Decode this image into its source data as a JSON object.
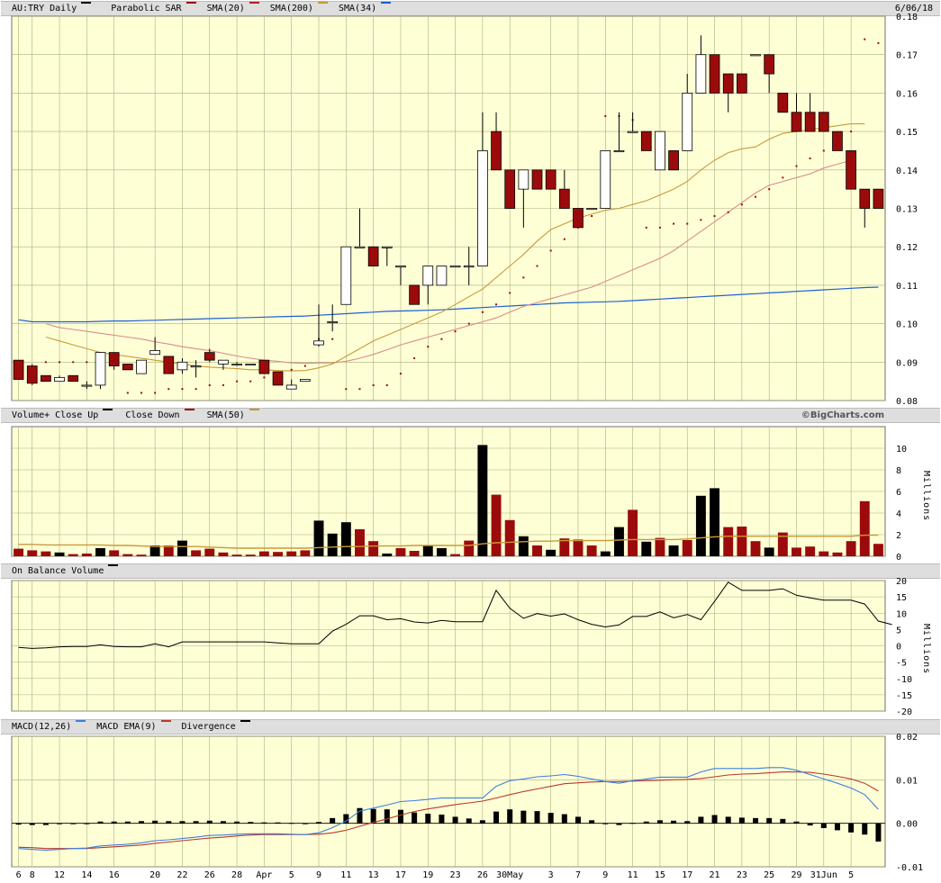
{
  "header": {
    "symbol_label": "AU:TRY Daily",
    "sar_label": "Parabolic SAR",
    "sma20_label": "SMA(20)",
    "sma200_label": "SMA(200)",
    "sma34_label": "SMA(34)",
    "date": "6/06/18"
  },
  "volume_header": {
    "label": "Volume+ Close Up",
    "close_down_label": "Close Down",
    "sma50_label": "SMA(50)",
    "credit": "©BigCharts.com"
  },
  "obv_header": {
    "label": "On Balance Volume"
  },
  "macd_header": {
    "macd_label": "MACD(12,26)",
    "ema_label": "MACD EMA(9)",
    "div_label": "Divergence"
  },
  "colors": {
    "up": "#000000",
    "down": "#9b0b0b",
    "sma20": "#b2221f",
    "sma200": "#1f5fd1",
    "sma34": "#d98c8c",
    "sma50": "#c89a3a",
    "macd": "#3d7fe0",
    "ema": "#b83a2a",
    "grid": "#a7b07a",
    "panel": "#ffffd6"
  },
  "chart_data": [
    {
      "type": "candlestick",
      "title": "AU:TRY Daily",
      "ylim": [
        0.08,
        0.18
      ],
      "y_ticks": [
        "0.18",
        "0.17",
        "0.16",
        "0.15",
        "0.14",
        "0.13",
        "0.12",
        "0.11",
        "0.10",
        "0.09",
        "0.08"
      ],
      "x_tick_labels": [
        "6",
        "8",
        "12",
        "14",
        "16",
        "20",
        "22",
        "26",
        "28",
        "Apr",
        "5",
        "9",
        "11",
        "13",
        "17",
        "19",
        "23",
        "26",
        "30May",
        "3",
        "7",
        "9",
        "11",
        "15",
        "17",
        "21",
        "23",
        "25",
        "29",
        "31Jun",
        "5"
      ],
      "candles": [
        {
          "o": 0.0905,
          "h": 0.0905,
          "l": 0.0855,
          "c": 0.0855
        },
        {
          "o": 0.089,
          "h": 0.0895,
          "l": 0.084,
          "c": 0.0845
        },
        {
          "o": 0.0865,
          "h": 0.0865,
          "l": 0.085,
          "c": 0.085
        },
        {
          "o": 0.085,
          "h": 0.0865,
          "l": 0.085,
          "c": 0.086
        },
        {
          "o": 0.0865,
          "h": 0.0865,
          "l": 0.085,
          "c": 0.085
        },
        {
          "o": 0.084,
          "h": 0.085,
          "l": 0.083,
          "c": 0.084
        },
        {
          "o": 0.084,
          "h": 0.0925,
          "l": 0.083,
          "c": 0.0925
        },
        {
          "o": 0.0925,
          "h": 0.0925,
          "l": 0.088,
          "c": 0.089
        },
        {
          "o": 0.0895,
          "h": 0.0895,
          "l": 0.088,
          "c": 0.088
        },
        {
          "o": 0.087,
          "h": 0.0905,
          "l": 0.087,
          "c": 0.0905
        },
        {
          "o": 0.092,
          "h": 0.0965,
          "l": 0.092,
          "c": 0.093
        },
        {
          "o": 0.0915,
          "h": 0.0915,
          "l": 0.087,
          "c": 0.087
        },
        {
          "o": 0.088,
          "h": 0.091,
          "l": 0.087,
          "c": 0.09
        },
        {
          "o": 0.089,
          "h": 0.0905,
          "l": 0.086,
          "c": 0.089
        },
        {
          "o": 0.0925,
          "h": 0.0935,
          "l": 0.09,
          "c": 0.0905
        },
        {
          "o": 0.0895,
          "h": 0.0905,
          "l": 0.088,
          "c": 0.0905
        },
        {
          "o": 0.0895,
          "h": 0.09,
          "l": 0.089,
          "c": 0.0895
        },
        {
          "o": 0.0895,
          "h": 0.0895,
          "l": 0.0895,
          "c": 0.0895
        },
        {
          "o": 0.0905,
          "h": 0.0905,
          "l": 0.087,
          "c": 0.087
        },
        {
          "o": 0.0875,
          "h": 0.0875,
          "l": 0.084,
          "c": 0.084
        },
        {
          "o": 0.083,
          "h": 0.0855,
          "l": 0.083,
          "c": 0.084
        },
        {
          "o": 0.085,
          "h": 0.0855,
          "l": 0.085,
          "c": 0.0855
        },
        {
          "o": 0.0945,
          "h": 0.105,
          "l": 0.094,
          "c": 0.0955
        },
        {
          "o": 0.1005,
          "h": 0.105,
          "l": 0.098,
          "c": 0.1005
        },
        {
          "o": 0.105,
          "h": 0.12,
          "l": 0.105,
          "c": 0.12
        },
        {
          "o": 0.12,
          "h": 0.13,
          "l": 0.12,
          "c": 0.12
        },
        {
          "o": 0.12,
          "h": 0.12,
          "l": 0.115,
          "c": 0.115
        },
        {
          "o": 0.12,
          "h": 0.12,
          "l": 0.115,
          "c": 0.12
        },
        {
          "o": 0.115,
          "h": 0.115,
          "l": 0.11,
          "c": 0.115
        },
        {
          "o": 0.11,
          "h": 0.11,
          "l": 0.105,
          "c": 0.105
        },
        {
          "o": 0.11,
          "h": 0.115,
          "l": 0.105,
          "c": 0.115
        },
        {
          "o": 0.11,
          "h": 0.115,
          "l": 0.11,
          "c": 0.115
        },
        {
          "o": 0.115,
          "h": 0.115,
          "l": 0.115,
          "c": 0.115
        },
        {
          "o": 0.115,
          "h": 0.12,
          "l": 0.11,
          "c": 0.115
        },
        {
          "o": 0.115,
          "h": 0.155,
          "l": 0.115,
          "c": 0.145
        },
        {
          "o": 0.15,
          "h": 0.155,
          "l": 0.14,
          "c": 0.14
        },
        {
          "o": 0.14,
          "h": 0.14,
          "l": 0.13,
          "c": 0.13
        },
        {
          "o": 0.135,
          "h": 0.14,
          "l": 0.125,
          "c": 0.14
        },
        {
          "o": 0.14,
          "h": 0.14,
          "l": 0.135,
          "c": 0.135
        },
        {
          "o": 0.14,
          "h": 0.14,
          "l": 0.135,
          "c": 0.135
        },
        {
          "o": 0.135,
          "h": 0.14,
          "l": 0.13,
          "c": 0.13
        },
        {
          "o": 0.13,
          "h": 0.13,
          "l": 0.125,
          "c": 0.125
        },
        {
          "o": 0.13,
          "h": 0.13,
          "l": 0.13,
          "c": 0.13
        },
        {
          "o": 0.13,
          "h": 0.145,
          "l": 0.13,
          "c": 0.145
        },
        {
          "o": 0.145,
          "h": 0.155,
          "l": 0.145,
          "c": 0.145
        },
        {
          "o": 0.15,
          "h": 0.155,
          "l": 0.15,
          "c": 0.15
        },
        {
          "o": 0.15,
          "h": 0.15,
          "l": 0.145,
          "c": 0.145
        },
        {
          "o": 0.14,
          "h": 0.15,
          "l": 0.14,
          "c": 0.15
        },
        {
          "o": 0.145,
          "h": 0.145,
          "l": 0.14,
          "c": 0.14
        },
        {
          "o": 0.145,
          "h": 0.165,
          "l": 0.145,
          "c": 0.16
        },
        {
          "o": 0.16,
          "h": 0.175,
          "l": 0.16,
          "c": 0.17
        },
        {
          "o": 0.17,
          "h": 0.17,
          "l": 0.16,
          "c": 0.16
        },
        {
          "o": 0.165,
          "h": 0.165,
          "l": 0.155,
          "c": 0.16
        },
        {
          "o": 0.165,
          "h": 0.165,
          "l": 0.16,
          "c": 0.16
        },
        {
          "o": 0.17,
          "h": 0.17,
          "l": 0.17,
          "c": 0.17
        },
        {
          "o": 0.17,
          "h": 0.17,
          "l": 0.16,
          "c": 0.165
        },
        {
          "o": 0.16,
          "h": 0.16,
          "l": 0.155,
          "c": 0.155
        },
        {
          "o": 0.155,
          "h": 0.16,
          "l": 0.15,
          "c": 0.15
        },
        {
          "o": 0.155,
          "h": 0.16,
          "l": 0.15,
          "c": 0.15
        },
        {
          "o": 0.155,
          "h": 0.155,
          "l": 0.15,
          "c": 0.15
        },
        {
          "o": 0.15,
          "h": 0.15,
          "l": 0.145,
          "c": 0.145
        },
        {
          "o": 0.145,
          "h": 0.145,
          "l": 0.135,
          "c": 0.135
        },
        {
          "o": 0.135,
          "h": 0.135,
          "l": 0.125,
          "c": 0.13
        },
        {
          "o": 0.135,
          "h": 0.135,
          "l": 0.13,
          "c": 0.13
        }
      ],
      "sar": [
        0.09,
        null,
        0.09,
        0.09,
        0.09,
        0.09,
        0.09,
        0.09,
        0.082,
        0.082,
        0.082,
        0.083,
        0.083,
        0.083,
        0.084,
        0.084,
        0.085,
        0.085,
        0.086,
        0.087,
        0.088,
        0.089,
        0.096,
        0.096,
        0.083,
        0.083,
        0.084,
        0.084,
        0.087,
        0.091,
        0.094,
        0.096,
        0.098,
        0.1,
        0.103,
        0.105,
        0.108,
        0.112,
        0.115,
        0.119,
        0.122,
        0.125,
        0.128,
        0.154,
        0.154,
        0.153,
        0.125,
        0.125,
        0.126,
        0.126,
        0.127,
        0.128,
        0.129,
        0.131,
        0.133,
        0.135,
        0.138,
        0.141,
        0.143,
        0.145,
        0.147,
        0.15,
        0.174,
        0.173
      ],
      "sma20": [
        null,
        null,
        0.0965,
        0.0955,
        0.0945,
        0.0935,
        0.0925,
        0.092,
        0.0915,
        0.091,
        0.0905,
        0.09,
        0.0895,
        0.089,
        0.0887,
        0.0885,
        0.0883,
        0.088,
        0.088,
        0.0878,
        0.0877,
        0.0878,
        0.0885,
        0.0895,
        0.0915,
        0.0935,
        0.0955,
        0.097,
        0.0985,
        0.1,
        0.1015,
        0.103,
        0.105,
        0.107,
        0.109,
        0.112,
        0.115,
        0.118,
        0.1215,
        0.1245,
        0.126,
        0.1275,
        0.1285,
        0.1295,
        0.13,
        0.131,
        0.132,
        0.1335,
        0.135,
        0.137,
        0.14,
        0.1425,
        0.1445,
        0.1455,
        0.146,
        0.148,
        0.1495,
        0.15,
        0.1505,
        0.151,
        0.1515,
        0.152,
        0.152
      ],
      "sma34": [
        null,
        null,
        0.1,
        0.099,
        0.0985,
        0.098,
        0.0975,
        0.097,
        0.0965,
        0.096,
        0.0953,
        0.0947,
        0.094,
        0.0935,
        0.093,
        0.0923,
        0.0916,
        0.091,
        0.0905,
        0.0902,
        0.0898,
        0.0897,
        0.0898,
        0.0898,
        0.0902,
        0.091,
        0.092,
        0.0932,
        0.0945,
        0.0955,
        0.0965,
        0.0975,
        0.0985,
        0.0995,
        0.1005,
        0.1015,
        0.103,
        0.1045,
        0.1055,
        0.1065,
        0.1075,
        0.1085,
        0.1095,
        0.111,
        0.1125,
        0.114,
        0.1155,
        0.117,
        0.119,
        0.1215,
        0.124,
        0.1265,
        0.129,
        0.1315,
        0.134,
        0.136,
        0.137,
        0.138,
        0.139,
        0.1405,
        0.1415,
        0.1425
      ],
      "sma200": [
        0.101,
        0.1005,
        0.1005,
        0.1005,
        0.1005,
        0.1005,
        0.1006,
        0.1007,
        0.1007,
        0.1008,
        0.1009,
        0.101,
        0.1011,
        0.1012,
        0.1013,
        0.1014,
        0.1015,
        0.1016,
        0.1017,
        0.1018,
        0.1019,
        0.102,
        0.1022,
        0.1024,
        0.1026,
        0.1028,
        0.103,
        0.1032,
        0.1033,
        0.1034,
        0.1035,
        0.1036,
        0.1038,
        0.104,
        0.1042,
        0.1044,
        0.1046,
        0.1048,
        0.105,
        0.1052,
        0.1054,
        0.1055,
        0.1056,
        0.1057,
        0.1058,
        0.106,
        0.1062,
        0.1064,
        0.1066,
        0.1068,
        0.107,
        0.1072,
        0.1074,
        0.1076,
        0.1078,
        0.108,
        0.1082,
        0.1084,
        0.1086,
        0.1088,
        0.109,
        0.1092,
        0.1094,
        0.1095
      ]
    },
    {
      "type": "bar",
      "title": "Volume",
      "ylabel": "Millions",
      "ylim": [
        0,
        12
      ],
      "y_ticks": [
        "10",
        "8",
        "6",
        "4",
        "2",
        "0"
      ],
      "values": [
        0.7,
        0.55,
        0.45,
        0.35,
        0.2,
        0.25,
        0.75,
        0.55,
        0.2,
        0.15,
        1.0,
        1.0,
        1.45,
        0.55,
        0.7,
        0.35,
        0.15,
        0.15,
        0.45,
        0.4,
        0.45,
        0.55,
        3.3,
        2.1,
        3.15,
        2.5,
        1.4,
        0.25,
        0.75,
        0.5,
        1.0,
        0.75,
        0.2,
        1.45,
        10.3,
        5.7,
        3.35,
        1.85,
        1.0,
        0.6,
        1.65,
        1.55,
        1.0,
        0.45,
        2.7,
        4.3,
        1.35,
        1.7,
        1.0,
        1.5,
        5.6,
        6.3,
        2.7,
        2.75,
        1.4,
        0.8,
        2.2,
        0.8,
        0.9,
        0.45,
        0.35,
        1.4,
        5.1,
        1.15
      ],
      "up": [
        0,
        0,
        0,
        1,
        0,
        0,
        1,
        0,
        0,
        0,
        1,
        0,
        1,
        0,
        0,
        0,
        0,
        0,
        0,
        0,
        0,
        0,
        1,
        1,
        1,
        0,
        0,
        1,
        0,
        0,
        1,
        1,
        0,
        0,
        1,
        0,
        0,
        1,
        0,
        1,
        0,
        0,
        0,
        1,
        1,
        0,
        1,
        0,
        1,
        0,
        1,
        1,
        0,
        0,
        0,
        1,
        0,
        0,
        0,
        0,
        0,
        0,
        0,
        0
      ],
      "sma50": [
        1.1,
        1.1,
        1.05,
        1.05,
        1.05,
        1.05,
        1.05,
        1.0,
        1.0,
        0.95,
        0.9,
        0.9,
        0.9,
        0.9,
        0.85,
        0.8,
        0.75,
        0.75,
        0.75,
        0.75,
        0.75,
        0.75,
        0.8,
        0.85,
        0.9,
        0.9,
        0.95,
        0.95,
        0.95,
        1.0,
        1.0,
        1.0,
        1.0,
        1.0,
        1.15,
        1.25,
        1.3,
        1.35,
        1.4,
        1.4,
        1.45,
        1.45,
        1.45,
        1.45,
        1.5,
        1.55,
        1.55,
        1.55,
        1.55,
        1.6,
        1.7,
        1.8,
        1.85,
        1.85,
        1.85,
        1.85,
        1.85,
        1.85,
        1.85,
        1.85,
        1.85,
        1.85,
        1.95,
        1.95
      ]
    },
    {
      "type": "line",
      "title": "On Balance Volume",
      "ylabel": "Millions",
      "ylim": [
        -20,
        20
      ],
      "y_ticks": [
        "20",
        "15",
        "10",
        "5",
        "0",
        "-5",
        "-10",
        "-15",
        "-20"
      ],
      "values": [
        -0.5,
        -0.8,
        -0.6,
        -0.3,
        -0.2,
        -0.2,
        0.3,
        -0.2,
        -0.3,
        -0.3,
        0.6,
        -0.3,
        1.2,
        1.2,
        1.2,
        1.2,
        1.2,
        1.2,
        1.2,
        0.9,
        0.6,
        0.6,
        0.6,
        4.5,
        6.6,
        9.2,
        9.2,
        8.0,
        8.3,
        7.3,
        7.0,
        7.8,
        7.4,
        7.4,
        7.4,
        17.0,
        11.5,
        8.4,
        9.9,
        9.1,
        9.8,
        8.0,
        6.6,
        5.8,
        6.4,
        9.0,
        9.0,
        10.4,
        8.6,
        9.6,
        8.0,
        13.6,
        19.5,
        17.0,
        17.0,
        17.0,
        17.5,
        15.5,
        14.7,
        14.0,
        14.0,
        14.0,
        12.8,
        7.6,
        6.5
      ]
    },
    {
      "type": "line",
      "title": "MACD(12,26)",
      "ylim": [
        -0.01,
        0.02
      ],
      "y_ticks": [
        "0.02",
        "0.01",
        "0.00",
        "-0.01"
      ],
      "macd": [
        -0.0058,
        -0.006,
        -0.0062,
        -0.006,
        -0.0058,
        -0.0057,
        -0.0052,
        -0.005,
        -0.0048,
        -0.0045,
        -0.004,
        -0.0038,
        -0.0035,
        -0.0032,
        -0.0028,
        -0.0027,
        -0.0025,
        -0.0024,
        -0.0024,
        -0.0024,
        -0.0025,
        -0.0026,
        -0.0022,
        -0.001,
        0.0005,
        0.0028,
        0.0035,
        0.0042,
        0.005,
        0.0052,
        0.0055,
        0.0058,
        0.0058,
        0.0058,
        0.0058,
        0.0085,
        0.0098,
        0.0102,
        0.0107,
        0.0109,
        0.0112,
        0.0108,
        0.0102,
        0.0096,
        0.0092,
        0.0098,
        0.0102,
        0.0106,
        0.0106,
        0.0106,
        0.0118,
        0.0126,
        0.0126,
        0.0126,
        0.0126,
        0.0128,
        0.0128,
        0.0122,
        0.0112,
        0.0102,
        0.0092,
        0.0081,
        0.0066,
        0.0032
      ],
      "ema": [
        -0.0055,
        -0.0056,
        -0.0058,
        -0.0058,
        -0.0058,
        -0.0058,
        -0.0056,
        -0.0054,
        -0.0052,
        -0.005,
        -0.0046,
        -0.0043,
        -0.004,
        -0.0037,
        -0.0034,
        -0.0032,
        -0.0029,
        -0.0027,
        -0.0026,
        -0.0026,
        -0.0026,
        -0.0026,
        -0.0025,
        -0.0022,
        -0.0016,
        -0.0007,
        0.0002,
        0.001,
        0.0019,
        0.0027,
        0.0033,
        0.0038,
        0.0043,
        0.0047,
        0.0051,
        0.0058,
        0.0066,
        0.0073,
        0.0079,
        0.0085,
        0.0091,
        0.0093,
        0.0095,
        0.0096,
        0.0096,
        0.0097,
        0.0098,
        0.0099,
        0.01,
        0.0101,
        0.0103,
        0.0107,
        0.0111,
        0.0113,
        0.0114,
        0.0116,
        0.0118,
        0.0118,
        0.0117,
        0.0113,
        0.0108,
        0.0102,
        0.0092,
        0.0074
      ],
      "divergence": [
        -0.0003,
        -0.0004,
        -0.0004,
        -0.0002,
        0.0,
        0.0,
        0.0004,
        0.0004,
        0.0004,
        0.0005,
        0.0006,
        0.0005,
        0.0005,
        0.0005,
        0.0006,
        0.0005,
        0.0004,
        0.0003,
        0.0002,
        0.0002,
        0.0001,
        0.0,
        0.0003,
        0.0012,
        0.0021,
        0.0035,
        0.0033,
        0.0032,
        0.0031,
        0.0025,
        0.0022,
        0.002,
        0.0015,
        0.0011,
        0.0007,
        0.0027,
        0.0032,
        0.0029,
        0.0028,
        0.0024,
        0.0021,
        0.0015,
        0.0007,
        0.0,
        -0.0004,
        0.0001,
        0.0004,
        0.0007,
        0.0006,
        0.0005,
        0.0015,
        0.0019,
        0.0015,
        0.0013,
        0.0012,
        0.0012,
        0.001,
        0.0004,
        -0.0005,
        -0.0011,
        -0.0016,
        -0.0021,
        -0.0026,
        -0.0042
      ]
    }
  ]
}
